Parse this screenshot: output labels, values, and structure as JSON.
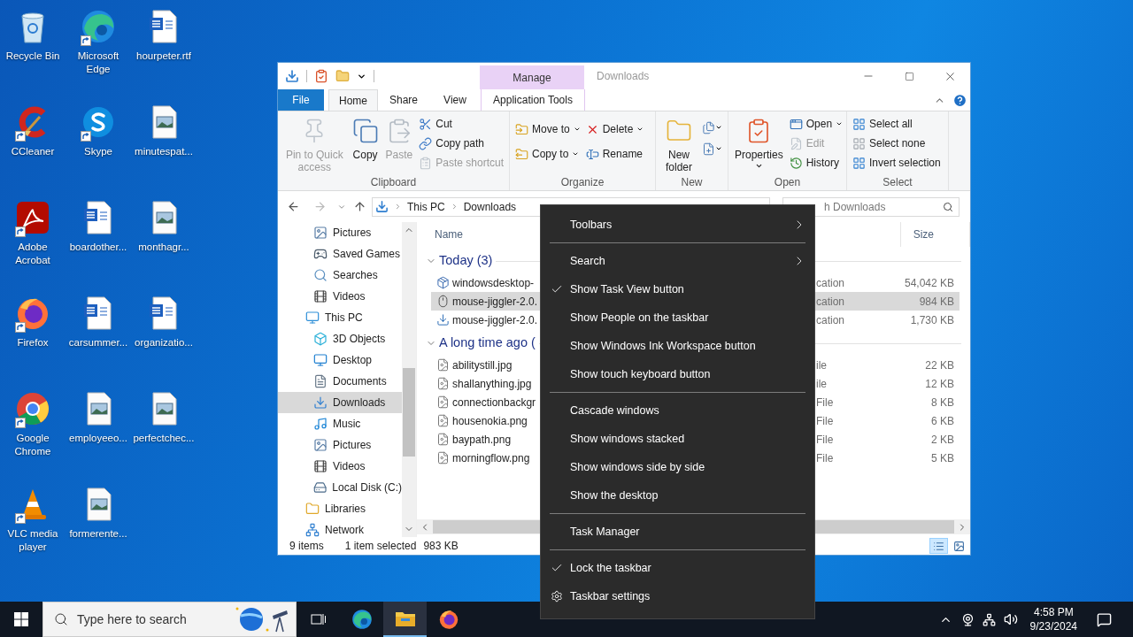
{
  "desktop": {
    "icons": [
      {
        "label": "Recycle Bin",
        "kind": "recycle",
        "shortcut": false
      },
      {
        "label": "CCleaner",
        "kind": "ccleaner",
        "shortcut": true
      },
      {
        "label": "Adobe Acrobat",
        "kind": "acrobat",
        "shortcut": true
      },
      {
        "label": "Firefox",
        "kind": "firefox",
        "shortcut": true
      },
      {
        "label": "Google Chrome",
        "kind": "chrome",
        "shortcut": true
      },
      {
        "label": "VLC media player",
        "kind": "vlc",
        "shortcut": true
      },
      {
        "label": "Microsoft Edge",
        "kind": "edge",
        "shortcut": true
      },
      {
        "label": "Skype",
        "kind": "skype",
        "shortcut": true
      },
      {
        "label": "boardother...",
        "kind": "document",
        "shortcut": false
      },
      {
        "label": "carsummer...",
        "kind": "document",
        "shortcut": false
      },
      {
        "label": "employeeo...",
        "kind": "image",
        "shortcut": false
      },
      {
        "label": "formerente...",
        "kind": "image",
        "shortcut": false
      },
      {
        "label": "hourpeter.rtf",
        "kind": "document",
        "shortcut": false
      },
      {
        "label": "minutespat...",
        "kind": "image",
        "shortcut": false
      },
      {
        "label": "monthagr...",
        "kind": "image",
        "shortcut": false
      },
      {
        "label": "organizatio...",
        "kind": "document",
        "shortcut": false
      },
      {
        "label": "perfectchec...",
        "kind": "image",
        "shortcut": false
      }
    ]
  },
  "explorer": {
    "contextual_group": "Manage",
    "title": "Downloads",
    "tabs": [
      {
        "label": "File",
        "kind": "file",
        "selected": false
      },
      {
        "label": "Home",
        "kind": "normal",
        "selected": true
      },
      {
        "label": "Share",
        "kind": "normal",
        "selected": false
      },
      {
        "label": "View",
        "kind": "normal",
        "selected": false
      },
      {
        "label": "Application Tools",
        "kind": "contextual",
        "selected": false
      }
    ],
    "ribbon": {
      "groups": [
        {
          "label": "Clipboard",
          "columns": [
            [
              {
                "label": "Pin to Quick access",
                "kind": "large",
                "disabled": true,
                "dropdown": false
              }
            ],
            [
              {
                "label": "Copy",
                "kind": "large",
                "disabled": false,
                "dropdown": false
              }
            ],
            [
              {
                "label": "Paste",
                "kind": "large",
                "disabled": true,
                "dropdown": false
              }
            ],
            [
              {
                "label": "Cut",
                "kind": "small",
                "disabled": false,
                "dropdown": false
              },
              {
                "label": "Copy path",
                "kind": "small",
                "disabled": false,
                "dropdown": false
              },
              {
                "label": "Paste shortcut",
                "kind": "small",
                "disabled": true,
                "dropdown": false
              }
            ]
          ]
        },
        {
          "label": "Organize",
          "columns": [
            [
              {
                "label": "Move to",
                "kind": "small",
                "disabled": false,
                "dropdown": true
              },
              {
                "label": "Copy to",
                "kind": "small",
                "disabled": false,
                "dropdown": true
              }
            ],
            [
              {
                "label": "Delete",
                "kind": "small",
                "disabled": false,
                "dropdown": true
              },
              {
                "label": "Rename",
                "kind": "small",
                "disabled": false,
                "dropdown": false
              }
            ]
          ]
        },
        {
          "label": "New",
          "columns": [
            [
              {
                "label": "New folder",
                "kind": "large",
                "disabled": false,
                "dropdown": false
              }
            ],
            [
              {
                "kind": "icon",
                "disabled": false,
                "dropdown": true
              },
              {
                "kind": "icon",
                "disabled": false,
                "dropdown": true
              }
            ]
          ]
        },
        {
          "label": "Open",
          "columns": [
            [
              {
                "label": "Properties",
                "kind": "large",
                "disabled": false,
                "dropdown": true
              }
            ],
            [
              {
                "label": "Open",
                "kind": "small",
                "disabled": false,
                "dropdown": true
              },
              {
                "label": "Edit",
                "kind": "small",
                "disabled": true,
                "dropdown": false
              },
              {
                "label": "History",
                "kind": "small",
                "disabled": false,
                "dropdown": false
              }
            ]
          ]
        },
        {
          "label": "Select",
          "columns": [
            [
              {
                "label": "Select all",
                "kind": "small",
                "disabled": false,
                "dropdown": false
              },
              {
                "label": "Select none",
                "kind": "small",
                "disabled": false,
                "dropdown": false
              },
              {
                "label": "Invert selection",
                "kind": "small",
                "disabled": false,
                "dropdown": false
              }
            ]
          ]
        }
      ]
    },
    "address": {
      "path": [
        "This PC",
        "Downloads"
      ]
    },
    "search": {
      "placeholder": "h Downloads"
    },
    "nav": {
      "continued_children": [
        {
          "label": "Pictures",
          "selected": false
        },
        {
          "label": "Saved Games",
          "selected": false
        },
        {
          "label": "Searches",
          "selected": false
        },
        {
          "label": "Videos",
          "selected": false
        }
      ],
      "items": [
        {
          "label": "This PC",
          "selected": false,
          "children": [
            {
              "label": "3D Objects",
              "selected": false
            },
            {
              "label": "Desktop",
              "selected": false
            },
            {
              "label": "Documents",
              "selected": false
            },
            {
              "label": "Downloads",
              "selected": true
            },
            {
              "label": "Music",
              "selected": false
            },
            {
              "label": "Pictures",
              "selected": false
            },
            {
              "label": "Videos",
              "selected": false
            },
            {
              "label": "Local Disk (C:)",
              "selected": false
            }
          ]
        },
        {
          "label": "Libraries",
          "selected": false
        },
        {
          "label": "Network",
          "selected": false
        }
      ]
    },
    "files": {
      "columns": [
        "Name",
        "Size"
      ],
      "groups": [
        {
          "label": "Today (3)",
          "expanded": true,
          "files": [
            {
              "name": "windowsdesktop-",
              "type": "cation",
              "size": "54,042 KB",
              "selected": false
            },
            {
              "name": "mouse-jiggler-2.0.",
              "type": "cation",
              "size": "984 KB",
              "selected": true
            },
            {
              "name": "mouse-jiggler-2.0.",
              "type": "cation",
              "size": "1,730 KB",
              "selected": false
            }
          ]
        },
        {
          "label": "A long time ago (",
          "expanded": true,
          "files": [
            {
              "name": "abilitystill.jpg",
              "type": "ile",
              "size": "22 KB",
              "selected": false
            },
            {
              "name": "shallanything.jpg",
              "type": "ile",
              "size": "12 KB",
              "selected": false
            },
            {
              "name": "connectionbackgr",
              "type": "File",
              "size": "8 KB",
              "selected": false
            },
            {
              "name": "housenokia.png",
              "type": "File",
              "size": "6 KB",
              "selected": false
            },
            {
              "name": "baypath.png",
              "type": "File",
              "size": "2 KB",
              "selected": false
            },
            {
              "name": "morningflow.png",
              "type": "File",
              "size": "5 KB",
              "selected": false
            }
          ]
        }
      ]
    },
    "views": [
      {
        "kind": "details",
        "selected": true
      },
      {
        "kind": "thumbnails",
        "selected": false
      }
    ],
    "status": {
      "count": "9 items",
      "selection": "1 item selected",
      "selection_size": "983 KB"
    }
  },
  "context_menu": {
    "groups": [
      [
        {
          "label": "Toolbars",
          "kind": "submenu"
        }
      ],
      [
        {
          "label": "Search",
          "kind": "submenu"
        },
        {
          "label": "Show Task View button",
          "kind": "toggle",
          "checked": true
        },
        {
          "label": "Show People on the taskbar",
          "kind": "toggle",
          "checked": false
        },
        {
          "label": "Show Windows Ink Workspace button",
          "kind": "toggle",
          "checked": false
        },
        {
          "label": "Show touch keyboard button",
          "kind": "toggle",
          "checked": false
        }
      ],
      [
        {
          "label": "Cascade windows",
          "kind": "command"
        },
        {
          "label": "Show windows stacked",
          "kind": "command"
        },
        {
          "label": "Show windows side by side",
          "kind": "command"
        },
        {
          "label": "Show the desktop",
          "kind": "command"
        }
      ],
      [
        {
          "label": "Task Manager",
          "kind": "command"
        }
      ],
      [
        {
          "label": "Lock the taskbar",
          "kind": "toggle",
          "checked": true
        },
        {
          "label": "Taskbar settings",
          "kind": "settings"
        }
      ]
    ]
  },
  "taskbar": {
    "search": {
      "placeholder": "Type here to search"
    },
    "apps": [
      {
        "kind": "taskview",
        "open": false
      },
      {
        "kind": "edge",
        "open": false
      },
      {
        "kind": "explorer",
        "open": true
      },
      {
        "kind": "firefox",
        "open": false
      }
    ],
    "clock": {
      "time": "4:58 PM",
      "date": "9/23/2024"
    }
  }
}
